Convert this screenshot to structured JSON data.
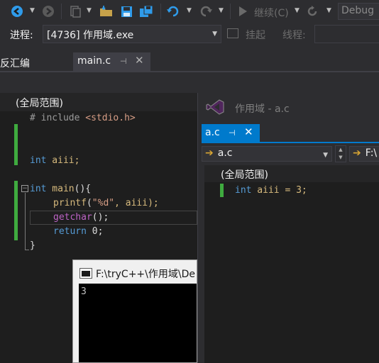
{
  "toolbar": {
    "continue_label": "继续(C)",
    "config_value": "Debug"
  },
  "process_bar": {
    "process_label": "进程:",
    "process_value": "[4736] 作用域.exe",
    "suspend_label": "挂起",
    "thread_label": "线程:"
  },
  "tabs": {
    "disassembly": "反汇编",
    "main_file": "main.c"
  },
  "left_editor": {
    "scope": "(全局范围)",
    "include_directive": "# include ",
    "include_header": "<stdio.h>",
    "var_type": "int",
    "var_name": " aiii;",
    "main_type": "int",
    "main_name": " main",
    "main_paren": "(){",
    "printf_name": "printf",
    "printf_open": "(",
    "printf_fmt": "\"%d\"",
    "printf_args": ", aiii);",
    "getchar_name": "getchar",
    "getchar_args": "();",
    "return_kw": "return",
    "return_val": " 0;",
    "close_brace": "}"
  },
  "right_pane": {
    "title": "作用域 - a.c",
    "tab": "a.c",
    "nav_file": "a.c",
    "nav_path": "F:\\",
    "scope": "(全局范围)",
    "code_type": "int",
    "code_rest": " aiii = 3;"
  },
  "console": {
    "title": "F:\\tryC++\\作用域\\De",
    "output": "3"
  }
}
